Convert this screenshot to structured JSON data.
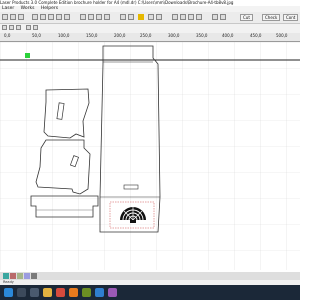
{
  "window": {
    "title": "Laser Products 3.0 Complete Edition brochure holder for A4 (mdl.dr) C:\\Users\\mm\\Downloads\\Brochure-A4-tb8v8.jpg"
  },
  "menu": {
    "items": [
      "Laser",
      "Works",
      "Helpers"
    ]
  },
  "toolbar": {
    "cut_label": "Cut",
    "check_label": "Check",
    "cont_label": "Cont"
  },
  "ruler": {
    "labels": [
      "0,0",
      "50,0",
      "100,0",
      "150,0",
      "200,0",
      "250,0",
      "300,0",
      "350,0",
      "400,0",
      "450,0",
      "500,0",
      "550,0",
      "600,0",
      "650,0",
      "700,0",
      "750,0",
      "800,0",
      "850,0",
      "900,0",
      "950,0"
    ]
  },
  "palette": {
    "colors": [
      "#3aa7a0",
      "#b96a6a",
      "#a5b58a",
      "#9c9ce0",
      "#7a7a7a"
    ]
  },
  "statusbar": {
    "text": "Ready"
  },
  "taskbar": {
    "icons": [
      "start-icon",
      "search-icon",
      "task-view-icon",
      "explorer-icon",
      "chrome-icon",
      "firefox-icon",
      "app-icon",
      "mail-icon",
      "photo-icon"
    ]
  }
}
